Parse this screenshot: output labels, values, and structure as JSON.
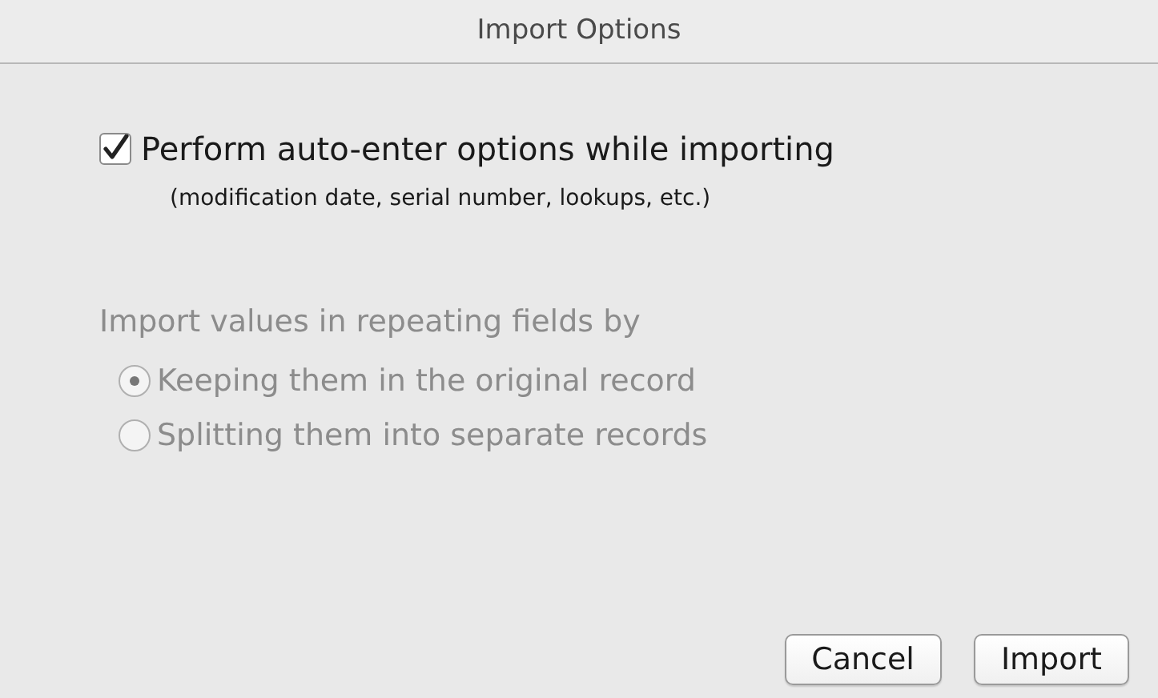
{
  "window": {
    "title": "Import Options"
  },
  "auto_enter": {
    "label": "Perform auto-enter options while importing",
    "note": "(modification date, serial number, lookups, etc.)",
    "checked": true
  },
  "repeating": {
    "label": "Import values in repeating fields by",
    "disabled": true,
    "options": [
      {
        "label": "Keeping them in the original record",
        "selected": true
      },
      {
        "label": "Splitting them into separate records",
        "selected": false
      }
    ]
  },
  "buttons": [
    "Cancel",
    "Import"
  ]
}
